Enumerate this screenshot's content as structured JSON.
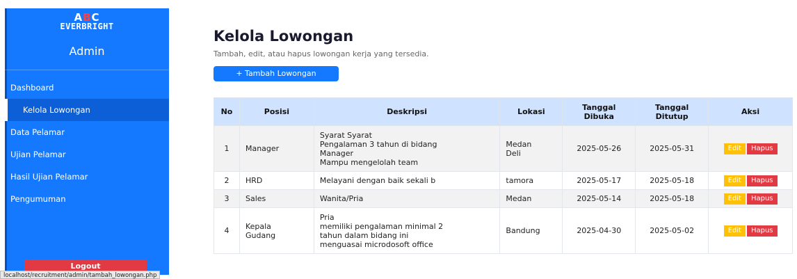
{
  "sidebar": {
    "logo_abc_a": "A",
    "logo_abc_b": "B",
    "logo_abc_c": "C",
    "logo_everbright": "EVERBRIGHT",
    "admin_title": "Admin",
    "items": [
      {
        "label": "Dashboard"
      },
      {
        "label": "Kelola Lowongan"
      },
      {
        "label": "Data Pelamar"
      },
      {
        "label": "Ujian Pelamar"
      },
      {
        "label": "Hasil Ujian Pelamar"
      },
      {
        "label": "Pengumuman"
      }
    ],
    "logout_label": "Logout"
  },
  "status_bar": {
    "url": "localhost/recruitment/admin/tambah_lowongan.php"
  },
  "main": {
    "title": "Kelola Lowongan",
    "subtitle": "Tambah, edit, atau hapus lowongan kerja yang tersedia.",
    "add_button": "+ Tambah Lowongan"
  },
  "table": {
    "headers": {
      "no": "No",
      "posisi": "Posisi",
      "deskripsi": "Deskripsi",
      "lokasi": "Lokasi",
      "dibuka_1": "Tanggal",
      "dibuka_2": "Dibuka",
      "ditutup_1": "Tanggal",
      "ditutup_2": "Ditutup",
      "aksi": "Aksi"
    },
    "edit_label": "Edit",
    "hapus_label": "Hapus",
    "rows": [
      {
        "no": "1",
        "posisi": "Manager",
        "deskripsi": [
          "Syarat Syarat",
          "Pengalaman 3 tahun di bidang",
          "Manager",
          "Mampu mengelolah team"
        ],
        "lokasi_1": "Medan",
        "lokasi_2": "Deli",
        "dibuka": "2025-05-26",
        "ditutup": "2025-05-31"
      },
      {
        "no": "2",
        "posisi": "HRD",
        "deskripsi": [
          "Melayani dengan baik sekali b"
        ],
        "lokasi_1": "tamora",
        "lokasi_2": "",
        "dibuka": "2025-05-17",
        "ditutup": "2025-05-18"
      },
      {
        "no": "3",
        "posisi": "Sales",
        "deskripsi": [
          "Wanita/Pria"
        ],
        "lokasi_1": "Medan",
        "lokasi_2": "",
        "dibuka": "2025-05-14",
        "ditutup": "2025-05-18"
      },
      {
        "no": "4",
        "posisi_1": "Kepala",
        "posisi_2": "Gudang",
        "deskripsi": [
          "Pria",
          "memiliki pengalaman minimal 2",
          "tahun dalam bidang ini",
          "menguasai microdosoft office"
        ],
        "lokasi_1": "Bandung",
        "lokasi_2": "",
        "dibuka": "2025-04-30",
        "ditutup": "2025-05-02"
      }
    ]
  },
  "colors": {
    "sidebar_bg": "#1479ff",
    "sidebar_active": "#0c5fd6",
    "header_bg": "#cfe2ff",
    "edit_btn": "#ffc107",
    "hapus_btn": "#e23a42"
  }
}
